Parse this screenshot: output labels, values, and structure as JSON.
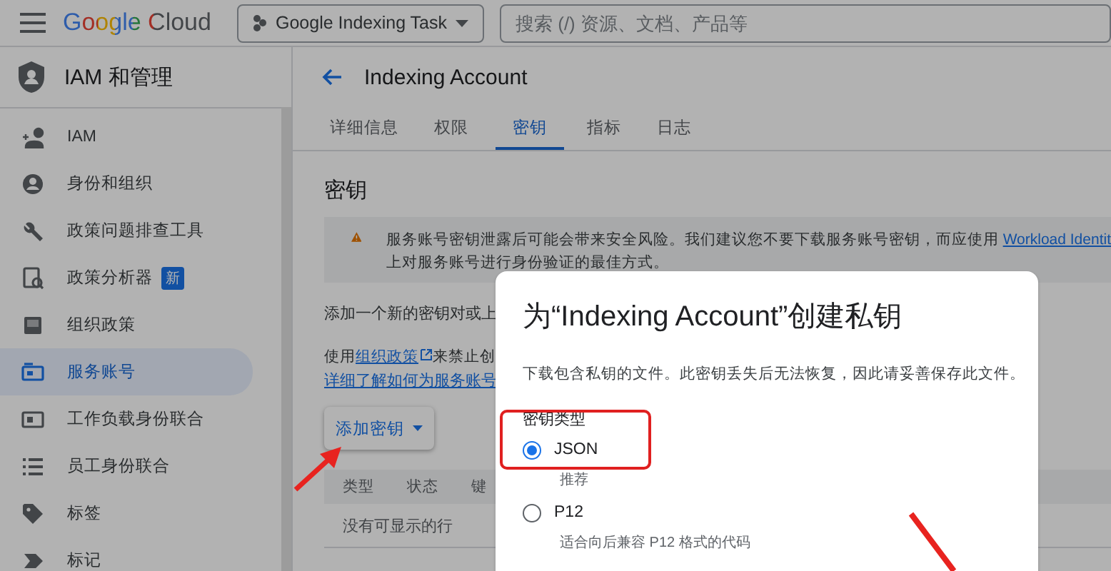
{
  "topbar": {
    "logo": "Google Cloud",
    "project": "Google Indexing Task",
    "search": {
      "placeholder": "搜索 (/) 资源、文档、产品等"
    }
  },
  "sidebar": {
    "title": "IAM 和管理",
    "items": [
      {
        "label": "IAM",
        "selected": false
      },
      {
        "label": "身份和组织",
        "selected": false
      },
      {
        "label": "政策问题排查工具",
        "selected": false
      },
      {
        "label": "政策分析器",
        "badge": "新",
        "selected": false
      },
      {
        "label": "组织政策",
        "selected": false
      },
      {
        "label": "服务账号",
        "selected": true
      },
      {
        "label": "工作负载身份联合",
        "selected": false
      },
      {
        "label": "员工身份联合",
        "selected": false
      },
      {
        "label": "标签",
        "selected": false
      },
      {
        "label": "标记",
        "selected": false
      }
    ]
  },
  "main": {
    "title": "Indexing Account",
    "tabs": [
      {
        "label": "详细信息",
        "selected": false
      },
      {
        "label": "权限",
        "selected": false
      },
      {
        "label": "密钥",
        "selected": true
      },
      {
        "label": "指标",
        "selected": false
      },
      {
        "label": "日志",
        "selected": false
      }
    ],
    "section_title": "密钥",
    "banner": {
      "text": "服务账号密钥泄露后可能会带来安全风险。我们建议您不要下载服务账号密钥，而应使用 ",
      "link": "Workload Identit",
      "text_2": "上对服务账号进行身份验证的最佳方式。"
    },
    "intro": "添加一个新的密钥对或上",
    "policy_line": {
      "prefix": "使用",
      "link": "组织政策",
      "suffix": "来禁止创"
    },
    "learn_more": "详细了解如何为服务账号",
    "add_key_button": "添加密钥",
    "table": {
      "columns": [
        "类型",
        "状态",
        "键"
      ],
      "empty": "没有可显示的行"
    }
  },
  "dialog": {
    "title": "为“Indexing Account”创建私钥",
    "description": "下载包含私钥的文件。此密钥丢失后无法恢复，因此请妥善保存此文件。",
    "key_type_label": "密钥类型",
    "options": [
      {
        "label": "JSON",
        "hint": "推荐",
        "selected": true
      },
      {
        "label": "P12",
        "hint": "适合向后兼容 P12 格式的代码",
        "selected": false
      }
    ]
  }
}
